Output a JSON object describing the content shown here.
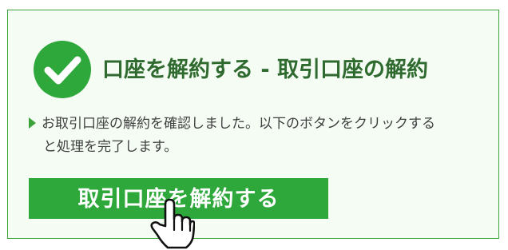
{
  "panel": {
    "title": "口座を解約する - 取引口座の解約",
    "message_line1": "お取引口座の解約を確認しました。以下のボタンをクリックする",
    "message_line2": "と処理を完了します。",
    "button_label": "取引口座を解約する",
    "icons": {
      "status": "check-circle-icon",
      "bullet": "triangle-bullet-icon",
      "cursor": "hand-pointer-icon"
    }
  },
  "colors": {
    "accent": "#2ea83a",
    "title": "#2f6a2f",
    "panel_background": "#f4fcf4",
    "panel_border": "#3aa33a",
    "text": "#404040"
  }
}
